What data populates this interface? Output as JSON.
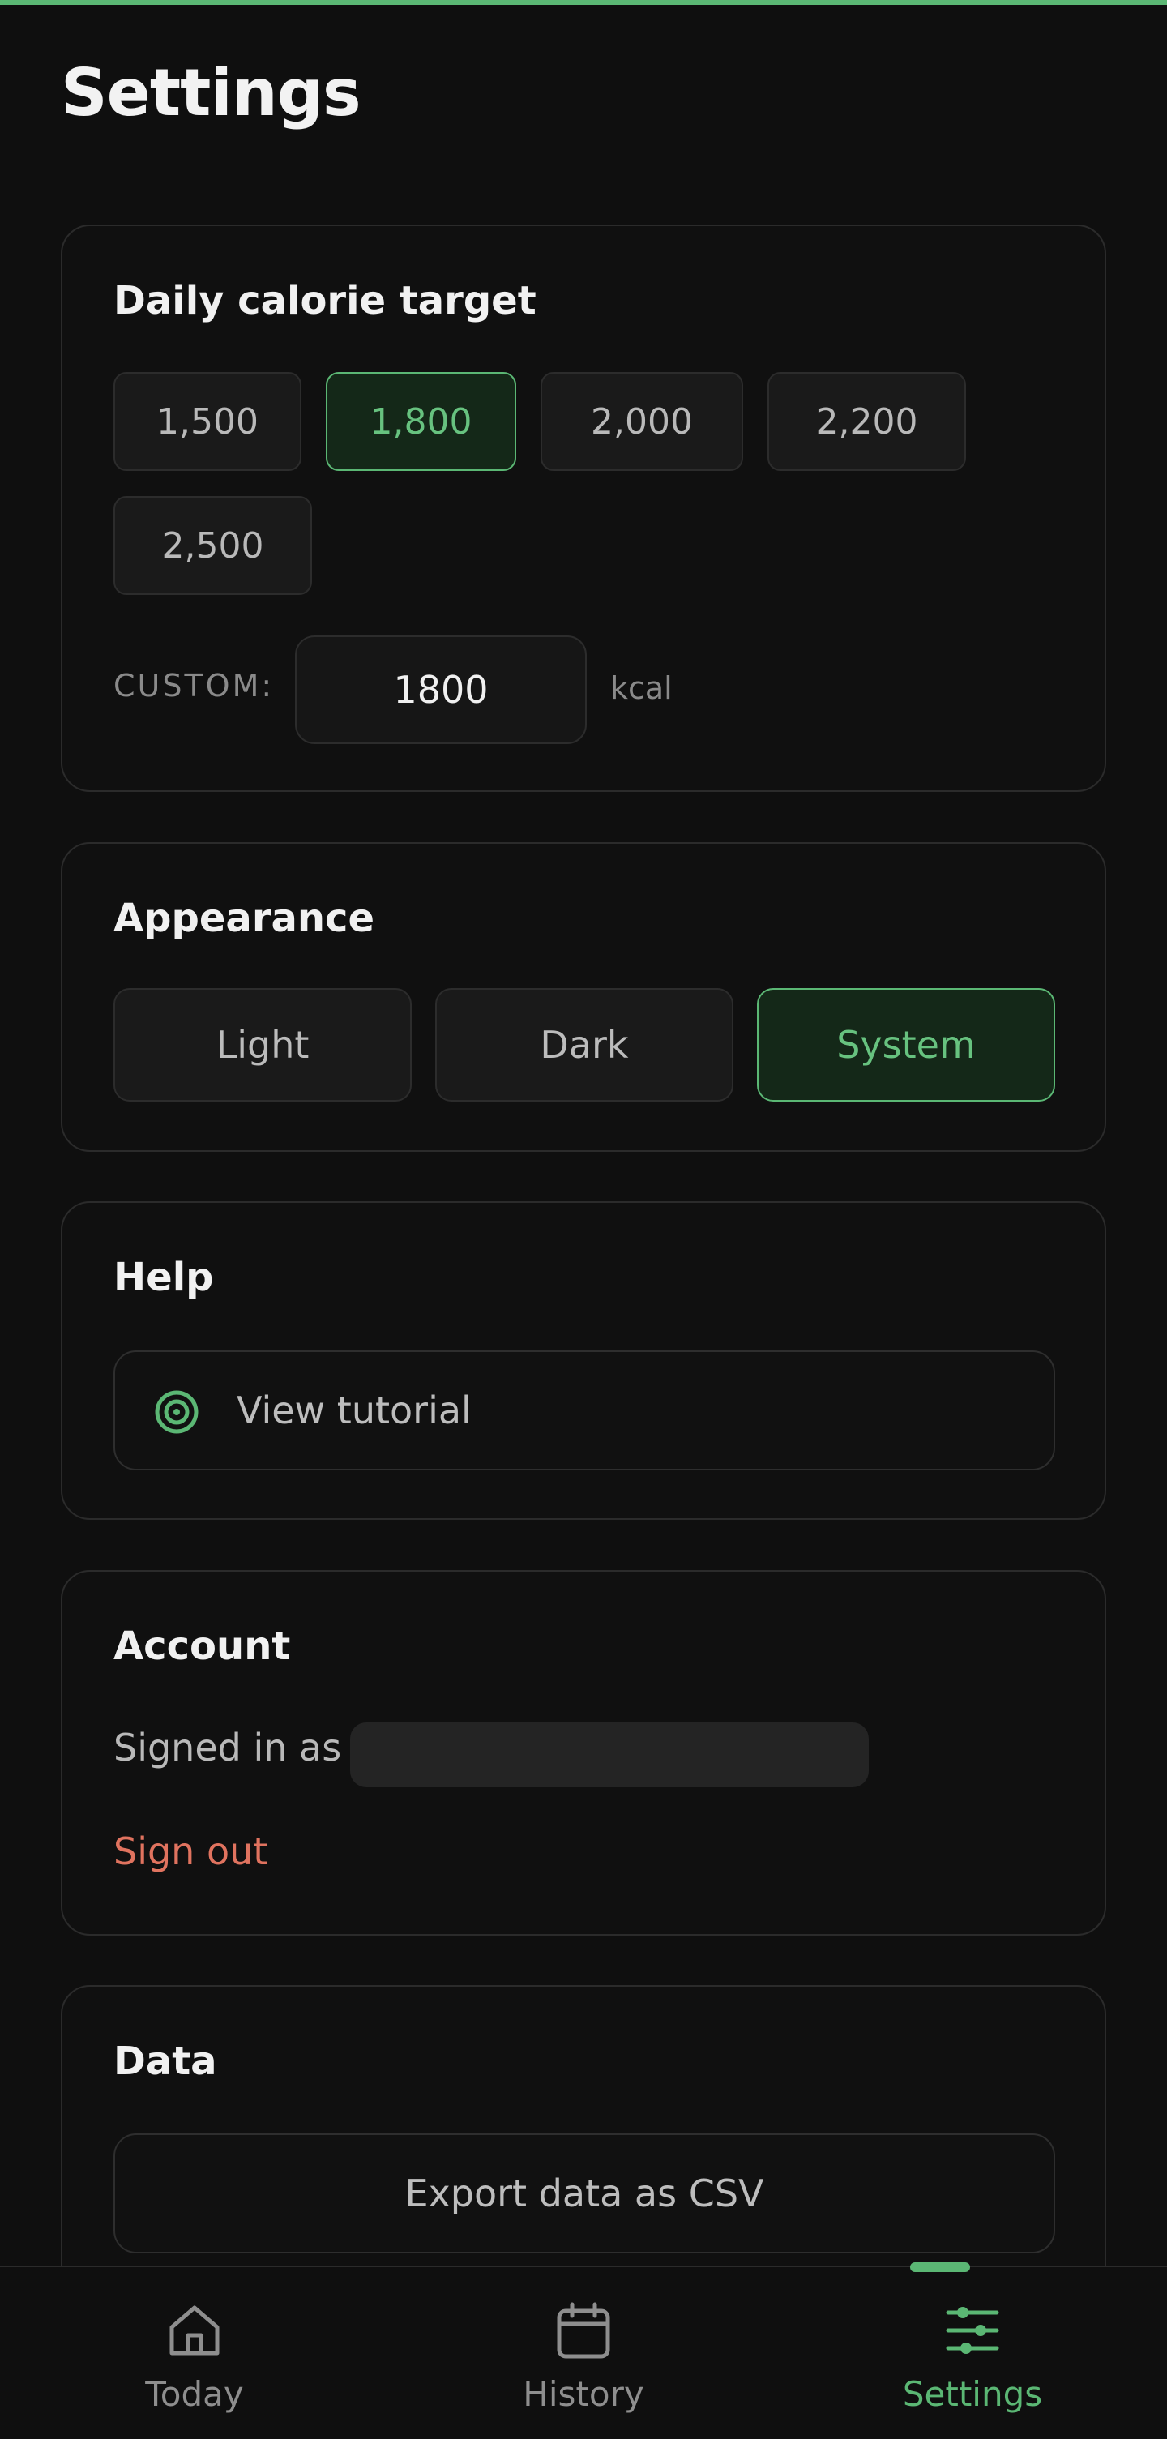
{
  "page": {
    "title": "Settings"
  },
  "colors": {
    "accent": "#5bb774",
    "danger": "#e0735f",
    "background": "#0f0f0f"
  },
  "calorie": {
    "title": "Daily calorie target",
    "presets": [
      "1,500",
      "1,800",
      "2,000",
      "2,200",
      "2,500"
    ],
    "selected": "1,800",
    "custom_label": "CUSTOM:",
    "custom_value": "1800",
    "unit": "kcal"
  },
  "appearance": {
    "title": "Appearance",
    "options": [
      "Light",
      "Dark",
      "System"
    ],
    "selected": "System"
  },
  "help": {
    "title": "Help",
    "tutorial_label": "View tutorial",
    "icon": "target-icon"
  },
  "account": {
    "title": "Account",
    "signed_in_prefix": "Signed in as",
    "sign_out": "Sign out"
  },
  "data": {
    "title": "Data",
    "export_label": "Export data as CSV"
  },
  "nav": {
    "items": [
      {
        "label": "Today",
        "icon": "home-icon"
      },
      {
        "label": "History",
        "icon": "calendar-icon"
      },
      {
        "label": "Settings",
        "icon": "sliders-icon"
      }
    ],
    "active": "Settings"
  }
}
